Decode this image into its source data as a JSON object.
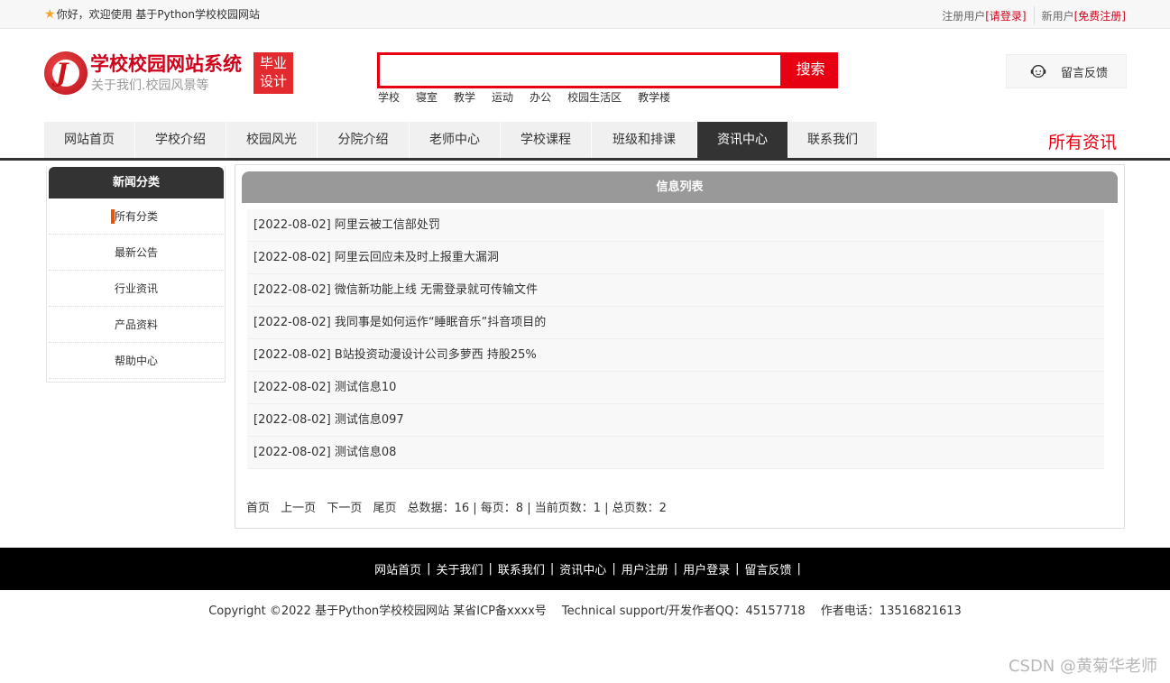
{
  "topbar": {
    "welcome": "你好，欢迎使用 基于Python学校校园网站",
    "register_prefix": "注册用户",
    "login_link": "[请登录]",
    "new_prefix": "新用户",
    "free_register_link": "[免费注册]"
  },
  "header": {
    "site_title": "学校校园网站系统",
    "site_subtitle": "关于我们.校园风景等",
    "badge_line1": "毕业",
    "badge_line2": "设计",
    "search_placeholder": "",
    "search_button": "搜索",
    "hot_words": [
      "学校",
      "寝室",
      "教学",
      "运动",
      "办公",
      "校园生活区",
      "教学楼"
    ],
    "feedback_label": "留言反馈"
  },
  "nav": {
    "items": [
      {
        "label": "网站首页",
        "active": false
      },
      {
        "label": "学校介绍",
        "active": false
      },
      {
        "label": "校园风光",
        "active": false
      },
      {
        "label": "分院介绍",
        "active": false
      },
      {
        "label": "老师中心",
        "active": false
      },
      {
        "label": "学校课程",
        "active": false
      },
      {
        "label": "班级和排课",
        "active": false
      },
      {
        "label": "资讯中心",
        "active": true
      },
      {
        "label": "联系我们",
        "active": false
      }
    ],
    "section_title": "所有资讯"
  },
  "sidebar": {
    "title": "新闻分类",
    "items": [
      {
        "label": "所有分类",
        "active": true
      },
      {
        "label": "最新公告",
        "active": false
      },
      {
        "label": "行业资讯",
        "active": false
      },
      {
        "label": "产品资料",
        "active": false
      },
      {
        "label": "帮助中心",
        "active": false
      }
    ]
  },
  "main": {
    "title": "信息列表",
    "news": [
      "[2022-08-02] 阿里云被工信部处罚",
      "[2022-08-02] 阿里云回应未及时上报重大漏洞",
      "[2022-08-02] 微信新功能上线 无需登录就可传输文件",
      "[2022-08-02] 我同事是如何运作“睡眠音乐”抖音项目的",
      "[2022-08-02] B站投资动漫设计公司多萝西 持股25%",
      "[2022-08-02] 测试信息10",
      "[2022-08-02] 测试信息097",
      "[2022-08-02] 测试信息08"
    ],
    "pager": {
      "first": "首页",
      "prev": "上一页",
      "next": "下一页",
      "last": "尾页",
      "stats": "总数据：16 | 每页：8 | 当前页数：1 | 总页数：2"
    }
  },
  "footer": {
    "links": [
      "网站首页",
      "关于我们",
      "联系我们",
      "资讯中心",
      "用户注册",
      "用户登录",
      "留言反馈"
    ],
    "separator": "|",
    "copyright": "Copyright ©2022 基于Python学校校园网站 某省ICP备xxxx号　 Technical support/开发作者QQ：45157718　 作者电话：13516821613",
    "watermark": "CSDN @黄菊华老师"
  },
  "colors": {
    "brand_red": "#e60012",
    "nav_active": "#333333",
    "accent_orange": "#e8540c"
  }
}
